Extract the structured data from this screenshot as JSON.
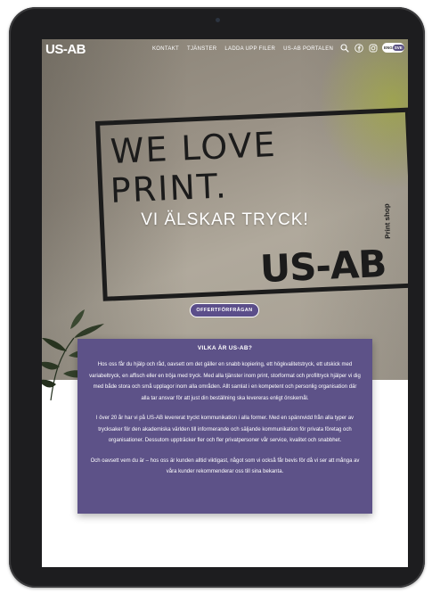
{
  "nav": {
    "logo": "US-AB",
    "links": [
      "KONTAKT",
      "TJÄNSTER",
      "LADDA UPP FILER",
      "US-AB PORTALEN"
    ],
    "icons": [
      "search-icon",
      "facebook-icon",
      "instagram-icon"
    ],
    "languages": [
      "ENG",
      "SVE"
    ]
  },
  "hero": {
    "wall_line1": "WE LOVE",
    "wall_line2": "PRINT.",
    "wall_brand": "US-AB",
    "wall_tag": "Print shop",
    "tagline": "VI ÄLSKAR TRYCK!",
    "cta": "OFFERTFÖRFRÅGAN"
  },
  "about": {
    "title": "VILKA ÄR US-AB?",
    "paragraphs": [
      "Hos oss får du hjälp och råd, oavsett om det gäller en snabb kopiering, ett högkvalitetstryck, ett utskick med variabeltryck, en affisch eller en tröja med tryck. Med alla tjänster inom print, storformat och profiltryck hjälper vi dig med både stora och små upplagor inom alla områden. Allt samlat i en kompetent och personlig organisation där alla tar ansvar för att just din beställning ska levereras enligt önskemål.",
      "I över 20 år har vi på US-AB levererat tryckt kommunikation i alla former. Med en spännvidd från alla typer av trycksaker för den akademiska världen till informerande och säljande kommunikation för privata företag och organisationer. Dessutom uppträcker fler och fler privatpersoner vår service, kvalitet och snabbhet.",
      "Och oavsett vem du är – hos oss är kunden alltid viktigast, något som vi också får bevis för då vi ser att många av våra kunder rekommenderar oss till sina bekanta."
    ]
  },
  "colors": {
    "accent": "#5d5288",
    "device_frame": "#1d1d1f"
  }
}
